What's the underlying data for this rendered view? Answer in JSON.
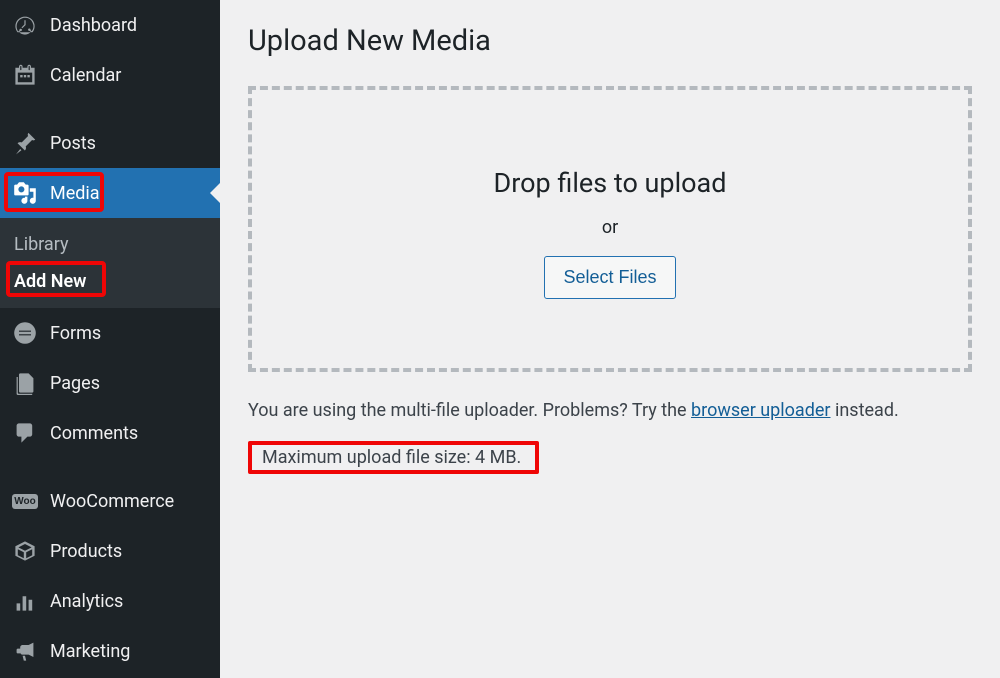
{
  "sidebar": {
    "items": [
      {
        "label": "Dashboard"
      },
      {
        "label": "Calendar"
      },
      {
        "label": "Posts"
      },
      {
        "label": "Media"
      },
      {
        "label": "Forms"
      },
      {
        "label": "Pages"
      },
      {
        "label": "Comments"
      },
      {
        "label": "WooCommerce"
      },
      {
        "label": "Products"
      },
      {
        "label": "Analytics"
      },
      {
        "label": "Marketing"
      }
    ],
    "submenu": {
      "library": "Library",
      "addnew": "Add New"
    }
  },
  "main": {
    "title": "Upload New Media",
    "dropzone": {
      "title": "Drop files to upload",
      "or": "or",
      "button": "Select Files"
    },
    "info_prefix": "You are using the multi-file uploader. Problems? Try the ",
    "info_link": "browser uploader",
    "info_suffix": " instead.",
    "max_upload": "Maximum upload file size: 4 MB."
  }
}
